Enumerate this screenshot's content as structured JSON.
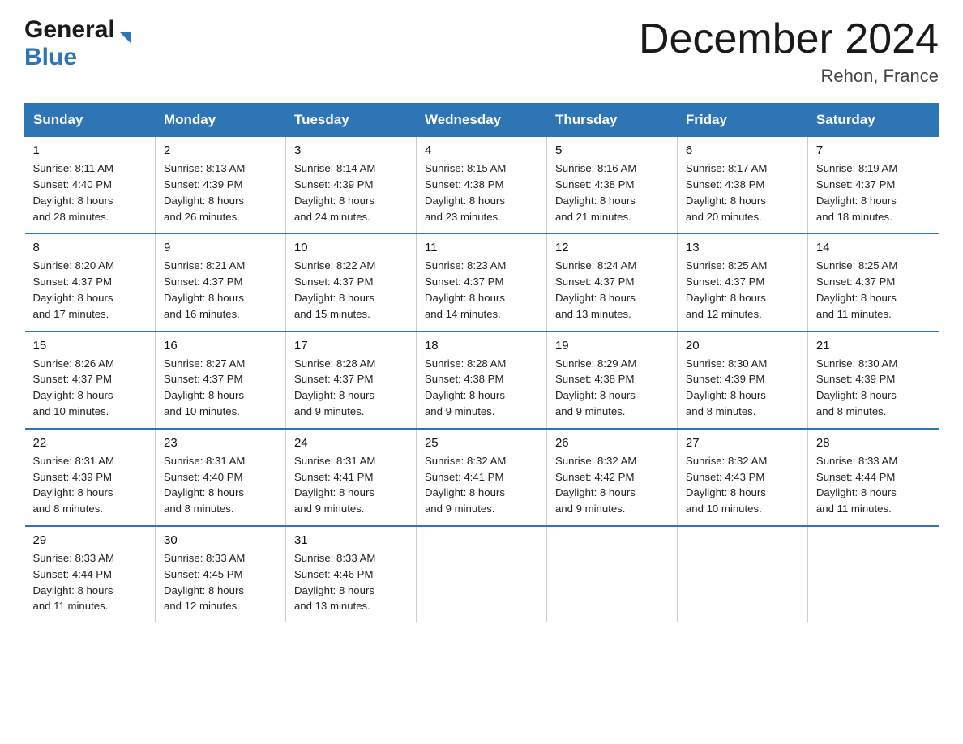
{
  "header": {
    "logo_general": "General",
    "logo_arrow": "▶",
    "logo_blue": "Blue",
    "month_title": "December 2024",
    "location": "Rehon, France"
  },
  "days_of_week": [
    "Sunday",
    "Monday",
    "Tuesday",
    "Wednesday",
    "Thursday",
    "Friday",
    "Saturday"
  ],
  "weeks": [
    [
      {
        "day": "1",
        "sunrise": "8:11 AM",
        "sunset": "4:40 PM",
        "daylight_hours": "8 hours",
        "daylight_minutes": "and 28 minutes."
      },
      {
        "day": "2",
        "sunrise": "8:13 AM",
        "sunset": "4:39 PM",
        "daylight_hours": "8 hours",
        "daylight_minutes": "and 26 minutes."
      },
      {
        "day": "3",
        "sunrise": "8:14 AM",
        "sunset": "4:39 PM",
        "daylight_hours": "8 hours",
        "daylight_minutes": "and 24 minutes."
      },
      {
        "day": "4",
        "sunrise": "8:15 AM",
        "sunset": "4:38 PM",
        "daylight_hours": "8 hours",
        "daylight_minutes": "and 23 minutes."
      },
      {
        "day": "5",
        "sunrise": "8:16 AM",
        "sunset": "4:38 PM",
        "daylight_hours": "8 hours",
        "daylight_minutes": "and 21 minutes."
      },
      {
        "day": "6",
        "sunrise": "8:17 AM",
        "sunset": "4:38 PM",
        "daylight_hours": "8 hours",
        "daylight_minutes": "and 20 minutes."
      },
      {
        "day": "7",
        "sunrise": "8:19 AM",
        "sunset": "4:37 PM",
        "daylight_hours": "8 hours",
        "daylight_minutes": "and 18 minutes."
      }
    ],
    [
      {
        "day": "8",
        "sunrise": "8:20 AM",
        "sunset": "4:37 PM",
        "daylight_hours": "8 hours",
        "daylight_minutes": "and 17 minutes."
      },
      {
        "day": "9",
        "sunrise": "8:21 AM",
        "sunset": "4:37 PM",
        "daylight_hours": "8 hours",
        "daylight_minutes": "and 16 minutes."
      },
      {
        "day": "10",
        "sunrise": "8:22 AM",
        "sunset": "4:37 PM",
        "daylight_hours": "8 hours",
        "daylight_minutes": "and 15 minutes."
      },
      {
        "day": "11",
        "sunrise": "8:23 AM",
        "sunset": "4:37 PM",
        "daylight_hours": "8 hours",
        "daylight_minutes": "and 14 minutes."
      },
      {
        "day": "12",
        "sunrise": "8:24 AM",
        "sunset": "4:37 PM",
        "daylight_hours": "8 hours",
        "daylight_minutes": "and 13 minutes."
      },
      {
        "day": "13",
        "sunrise": "8:25 AM",
        "sunset": "4:37 PM",
        "daylight_hours": "8 hours",
        "daylight_minutes": "and 12 minutes."
      },
      {
        "day": "14",
        "sunrise": "8:25 AM",
        "sunset": "4:37 PM",
        "daylight_hours": "8 hours",
        "daylight_minutes": "and 11 minutes."
      }
    ],
    [
      {
        "day": "15",
        "sunrise": "8:26 AM",
        "sunset": "4:37 PM",
        "daylight_hours": "8 hours",
        "daylight_minutes": "and 10 minutes."
      },
      {
        "day": "16",
        "sunrise": "8:27 AM",
        "sunset": "4:37 PM",
        "daylight_hours": "8 hours",
        "daylight_minutes": "and 10 minutes."
      },
      {
        "day": "17",
        "sunrise": "8:28 AM",
        "sunset": "4:37 PM",
        "daylight_hours": "8 hours",
        "daylight_minutes": "and 9 minutes."
      },
      {
        "day": "18",
        "sunrise": "8:28 AM",
        "sunset": "4:38 PM",
        "daylight_hours": "8 hours",
        "daylight_minutes": "and 9 minutes."
      },
      {
        "day": "19",
        "sunrise": "8:29 AM",
        "sunset": "4:38 PM",
        "daylight_hours": "8 hours",
        "daylight_minutes": "and 9 minutes."
      },
      {
        "day": "20",
        "sunrise": "8:30 AM",
        "sunset": "4:39 PM",
        "daylight_hours": "8 hours",
        "daylight_minutes": "and 8 minutes."
      },
      {
        "day": "21",
        "sunrise": "8:30 AM",
        "sunset": "4:39 PM",
        "daylight_hours": "8 hours",
        "daylight_minutes": "and 8 minutes."
      }
    ],
    [
      {
        "day": "22",
        "sunrise": "8:31 AM",
        "sunset": "4:39 PM",
        "daylight_hours": "8 hours",
        "daylight_minutes": "and 8 minutes."
      },
      {
        "day": "23",
        "sunrise": "8:31 AM",
        "sunset": "4:40 PM",
        "daylight_hours": "8 hours",
        "daylight_minutes": "and 8 minutes."
      },
      {
        "day": "24",
        "sunrise": "8:31 AM",
        "sunset": "4:41 PM",
        "daylight_hours": "8 hours",
        "daylight_minutes": "and 9 minutes."
      },
      {
        "day": "25",
        "sunrise": "8:32 AM",
        "sunset": "4:41 PM",
        "daylight_hours": "8 hours",
        "daylight_minutes": "and 9 minutes."
      },
      {
        "day": "26",
        "sunrise": "8:32 AM",
        "sunset": "4:42 PM",
        "daylight_hours": "8 hours",
        "daylight_minutes": "and 9 minutes."
      },
      {
        "day": "27",
        "sunrise": "8:32 AM",
        "sunset": "4:43 PM",
        "daylight_hours": "8 hours",
        "daylight_minutes": "and 10 minutes."
      },
      {
        "day": "28",
        "sunrise": "8:33 AM",
        "sunset": "4:44 PM",
        "daylight_hours": "8 hours",
        "daylight_minutes": "and 11 minutes."
      }
    ],
    [
      {
        "day": "29",
        "sunrise": "8:33 AM",
        "sunset": "4:44 PM",
        "daylight_hours": "8 hours",
        "daylight_minutes": "and 11 minutes."
      },
      {
        "day": "30",
        "sunrise": "8:33 AM",
        "sunset": "4:45 PM",
        "daylight_hours": "8 hours",
        "daylight_minutes": "and 12 minutes."
      },
      {
        "day": "31",
        "sunrise": "8:33 AM",
        "sunset": "4:46 PM",
        "daylight_hours": "8 hours",
        "daylight_minutes": "and 13 minutes."
      },
      null,
      null,
      null,
      null
    ]
  ],
  "labels": {
    "sunrise": "Sunrise:",
    "sunset": "Sunset:",
    "daylight": "Daylight:"
  }
}
